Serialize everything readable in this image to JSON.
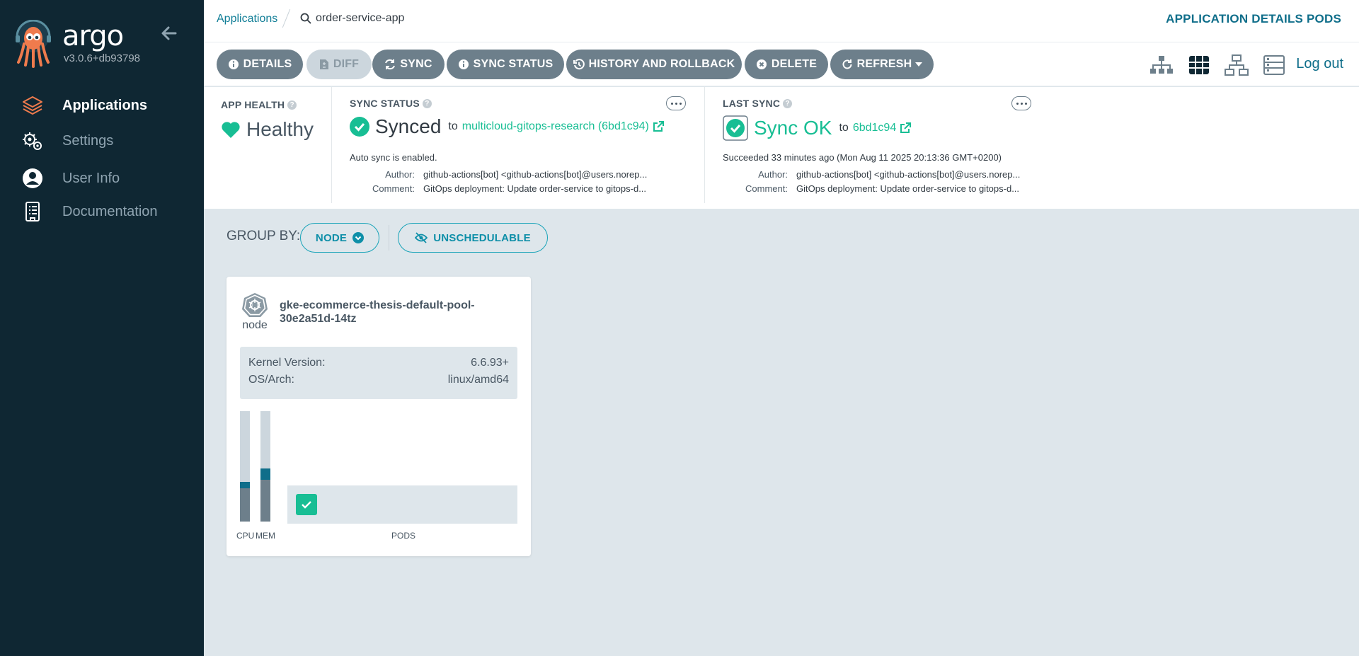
{
  "sidebar": {
    "brand": "argo",
    "version": "v3.0.6+db93798",
    "items": [
      {
        "label": "Applications",
        "icon": "layers-icon",
        "active": true
      },
      {
        "label": "Settings",
        "icon": "gears-icon",
        "active": false
      },
      {
        "label": "User Info",
        "icon": "user-circle-icon",
        "active": false
      },
      {
        "label": "Documentation",
        "icon": "book-icon",
        "active": false
      }
    ]
  },
  "topbar": {
    "breadcrumb": "Applications",
    "search_value": "order-service-app",
    "right_label": "APPLICATION DETAILS PODS"
  },
  "toolbar": {
    "buttons": [
      {
        "label": "DETAILS",
        "icon": "info-icon",
        "disabled": false
      },
      {
        "label": "DIFF",
        "icon": "file-diff-icon",
        "disabled": true
      },
      {
        "label": "SYNC",
        "icon": "sync-icon",
        "disabled": false
      },
      {
        "label": "SYNC STATUS",
        "icon": "info-icon",
        "disabled": false
      },
      {
        "label": "HISTORY AND ROLLBACK",
        "icon": "history-icon",
        "disabled": false
      },
      {
        "label": "DELETE",
        "icon": "times-circle-icon",
        "disabled": false
      },
      {
        "label": "REFRESH",
        "icon": "refresh-icon",
        "disabled": false
      }
    ],
    "logout": "Log out"
  },
  "status": {
    "health": {
      "title": "APP HEALTH",
      "value": "Healthy"
    },
    "sync": {
      "title": "SYNC STATUS",
      "value": "Synced",
      "to": "to",
      "target": "multicloud-gitops-research (6bd1c94)",
      "auto": "Auto sync is enabled.",
      "author_label": "Author:",
      "author": "github-actions[bot] <github-actions[bot]@users.norep...",
      "comment_label": "Comment:",
      "comment": "GitOps deployment: Update order-service to gitops-d..."
    },
    "last_sync": {
      "title": "LAST SYNC",
      "value": "Sync OK",
      "to": "to",
      "target": "6bd1c94",
      "succeeded": "Succeeded 33 minutes ago (Mon Aug 11 2025 20:13:36 GMT+0200)",
      "author_label": "Author:",
      "author": "github-actions[bot] <github-actions[bot]@users.norep...",
      "comment_label": "Comment:",
      "comment": "GitOps deployment: Update order-service to gitops-d..."
    }
  },
  "groupby": {
    "label": "GROUP BY:",
    "node_button": "NODE",
    "unschedulable_button": "UNSCHEDULABLE"
  },
  "node_card": {
    "kind": "node",
    "name": "gke-ecommerce-thesis-default-pool-30e2a51d-14tz",
    "kernel_label": "Kernel Version:",
    "kernel_value": "6.6.93+",
    "osarch_label": "OS/Arch:",
    "osarch_value": "linux/amd64",
    "cpu_label": "CPU",
    "mem_label": "MEM",
    "pods_label": "PODS",
    "cpu_used_fraction": 0.3,
    "cpu_requested_fraction": 0.06,
    "mem_used_fraction": 0.38,
    "mem_requested_fraction": 0.1
  },
  "colors": {
    "sidebar_bg": "#0f2733",
    "accent": "#0f6e8a",
    "healthy": "#18be94",
    "button_bg": "#6d7f8b"
  }
}
